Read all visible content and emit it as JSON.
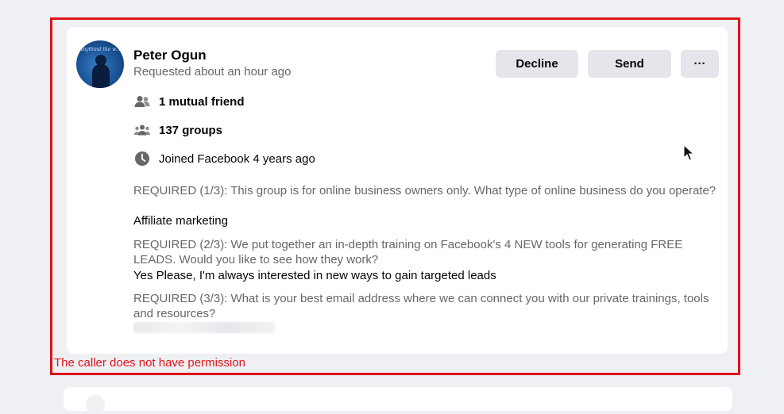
{
  "request": {
    "name": "Peter Ogun",
    "requested": "Requested about an hour ago",
    "avatar_text": "Anythind the w..."
  },
  "actions": {
    "decline_label": "Decline",
    "send_label": "Send",
    "more_label": "···"
  },
  "info": {
    "mutual": "1 mutual friend",
    "groups": "137 groups",
    "joined": "Joined Facebook 4 years ago"
  },
  "answers": [
    {
      "question": "REQUIRED (1/3): This group is for online business owners only. What type of online business do you operate?",
      "answer": "Affiliate marketing"
    },
    {
      "question": "REQUIRED (2/3): We put together an in-depth training on Facebook's 4 NEW tools for generating FREE LEADS. Would you like to see how they work?",
      "answer": "Yes Please, I'm always interested in new ways to gain targeted leads"
    },
    {
      "question": "REQUIRED (3/3): What is your best email address where we can connect you with our private trainings, tools and resources?"
    }
  ],
  "error_text": "The caller does not have permission",
  "colors": {
    "highlight_border": "#e0131a",
    "button_bg": "#e4e6eb",
    "secondary_text": "#65676b"
  },
  "icons": {
    "mutual": "people-icon",
    "groups": "groups-icon",
    "joined": "clock-icon"
  }
}
